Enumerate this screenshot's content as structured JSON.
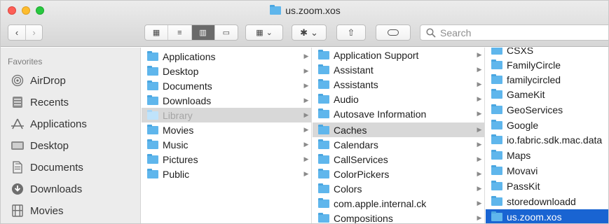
{
  "window": {
    "title": "us.zoom.xos"
  },
  "toolbar": {
    "back": "‹",
    "forward": "›",
    "view_icons": [
      "▦",
      "≡",
      "▥",
      "▭"
    ],
    "group_icon": "▦",
    "action_icon": "✱",
    "share_icon": "⇧",
    "search_placeholder": "Search"
  },
  "sidebar": {
    "header": "Favorites",
    "items": [
      {
        "label": "AirDrop",
        "icon": "airdrop-icon"
      },
      {
        "label": "Recents",
        "icon": "recents-icon"
      },
      {
        "label": "Applications",
        "icon": "applications-icon"
      },
      {
        "label": "Desktop",
        "icon": "desktop-icon"
      },
      {
        "label": "Documents",
        "icon": "documents-icon"
      },
      {
        "label": "Downloads",
        "icon": "downloads-icon"
      },
      {
        "label": "Movies",
        "icon": "movies-icon"
      }
    ]
  },
  "columns": {
    "col1": [
      {
        "label": "Applications"
      },
      {
        "label": "Desktop"
      },
      {
        "label": "Documents"
      },
      {
        "label": "Downloads"
      },
      {
        "label": "Library"
      },
      {
        "label": "Movies"
      },
      {
        "label": "Music"
      },
      {
        "label": "Pictures"
      },
      {
        "label": "Public"
      }
    ],
    "col2": [
      {
        "label": "Application Support"
      },
      {
        "label": "Assistant"
      },
      {
        "label": "Assistants"
      },
      {
        "label": "Audio"
      },
      {
        "label": "Autosave Information"
      },
      {
        "label": "Caches"
      },
      {
        "label": "Calendars"
      },
      {
        "label": "CallServices"
      },
      {
        "label": "ColorPickers"
      },
      {
        "label": "Colors"
      },
      {
        "label": "com.apple.internal.ck"
      },
      {
        "label": "Compositions"
      }
    ],
    "col3": [
      {
        "label": "CSXS"
      },
      {
        "label": "FamilyCircle"
      },
      {
        "label": "familycircled"
      },
      {
        "label": "GameKit"
      },
      {
        "label": "GeoServices"
      },
      {
        "label": "Google"
      },
      {
        "label": "io.fabric.sdk.mac.data"
      },
      {
        "label": "Maps"
      },
      {
        "label": "Movavi"
      },
      {
        "label": "PassKit"
      },
      {
        "label": "storedownloadd"
      },
      {
        "label": "us.zoom.xos"
      }
    ]
  },
  "colors": {
    "selection": "#1964d2",
    "highlight": "#d8d8d8",
    "folder": "#5fb6ec"
  }
}
